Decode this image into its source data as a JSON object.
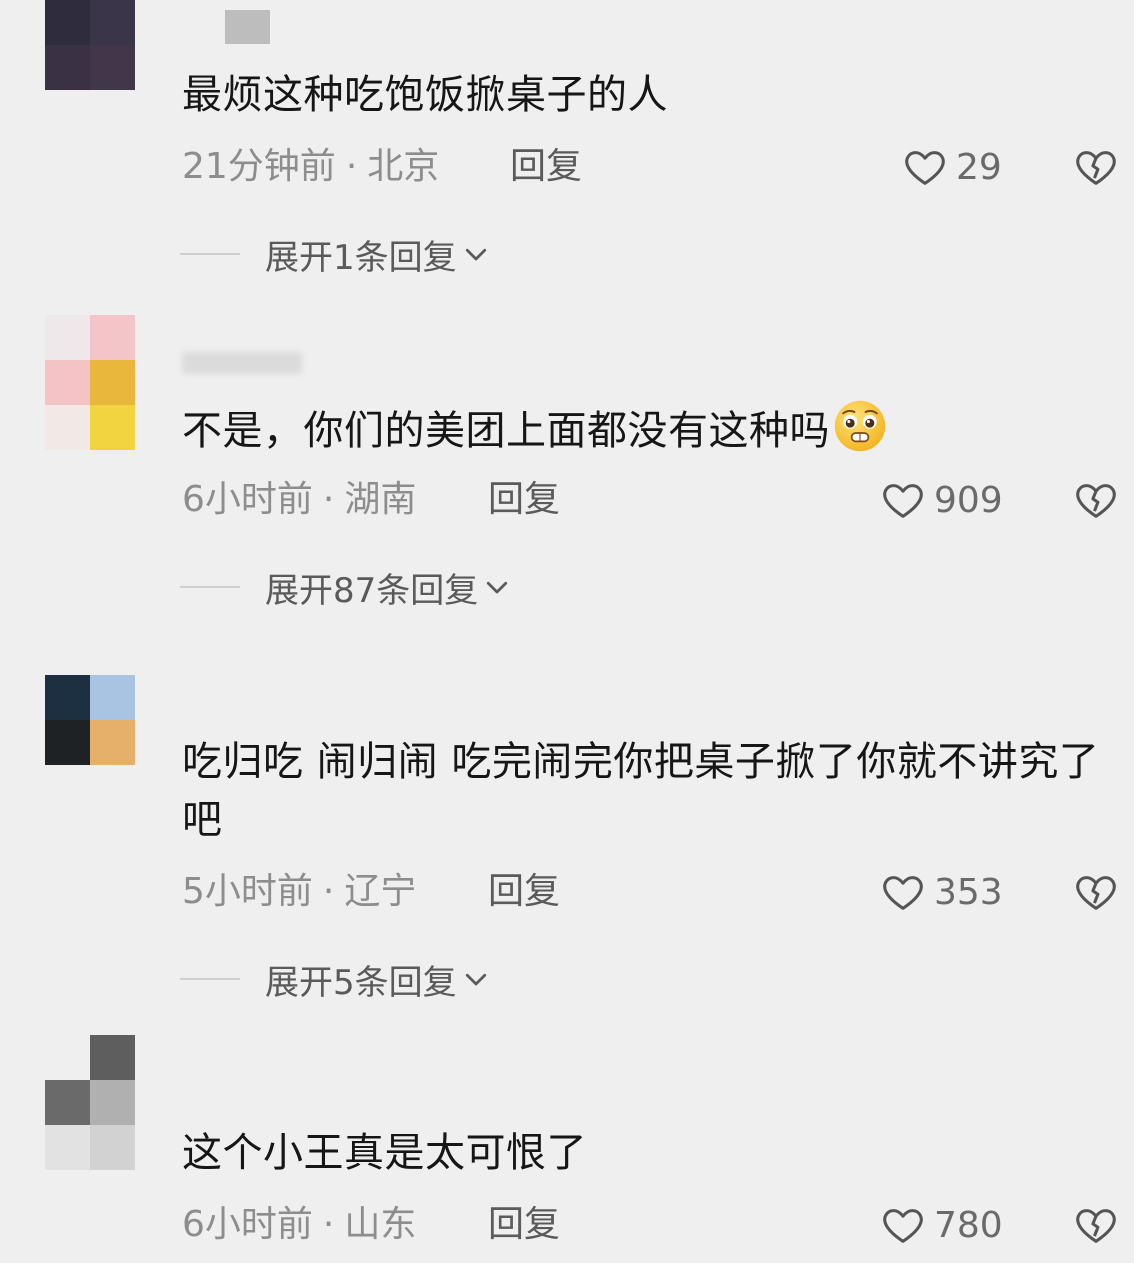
{
  "comments": [
    {
      "text": "最烦这种吃饱饭掀桌子的人",
      "time": "21分钟前",
      "separator": "·",
      "location": "北京",
      "reply_label": "回复",
      "likes": "29",
      "expand_label": "展开1条回复"
    },
    {
      "text": "不是，你们的美团上面都没有这种吗",
      "emoji": "pleading-face-emoji",
      "time": "6小时前",
      "separator": "·",
      "location": "湖南",
      "reply_label": "回复",
      "likes": "909",
      "expand_label": "展开87条回复"
    },
    {
      "text": "吃归吃 闹归闹 吃完闹完你把桌子掀了你就不讲究了吧",
      "time": "5小时前",
      "separator": "·",
      "location": "辽宁",
      "reply_label": "回复",
      "likes": "353",
      "expand_label": "展开5条回复"
    },
    {
      "text": "这个小王真是太可恨了",
      "time": "6小时前",
      "separator": "·",
      "location": "山东",
      "reply_label": "回复",
      "likes": "780"
    }
  ],
  "icons": {
    "like": "heart-outline-icon",
    "dislike": "broken-heart-icon",
    "expand": "chevron-down-icon"
  },
  "colors": {
    "background": "#efefef",
    "text": "#161616",
    "meta": "#8d8d8d"
  }
}
